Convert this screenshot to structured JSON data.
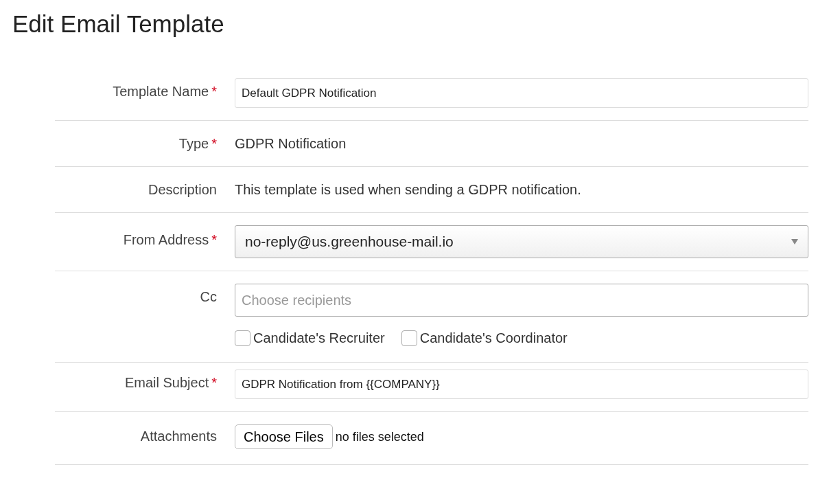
{
  "title": "Edit Email Template",
  "required_symbol": "*",
  "fields": [
    {
      "kind": "input",
      "label": "Template Name",
      "required": true,
      "value": "Default GDPR Notification"
    },
    {
      "kind": "static",
      "label": "Type",
      "required": true,
      "value": "GDPR Notification"
    },
    {
      "kind": "static",
      "label": "Description",
      "required": false,
      "value": "This template is used when sending a GDPR notification."
    },
    {
      "kind": "select",
      "label": "From Address",
      "required": true,
      "value": "no-reply@us.greenhouse-mail.io"
    },
    {
      "kind": "recipients",
      "label": "Cc",
      "required": false,
      "placeholder": "Choose recipients",
      "options": [
        {
          "label": "Candidate's Recruiter",
          "checked": false
        },
        {
          "label": "Candidate's Coordinator",
          "checked": false
        }
      ]
    },
    {
      "kind": "input",
      "label": "Email Subject",
      "required": true,
      "value": "GDPR Notification from {{COMPANY}}"
    },
    {
      "kind": "file",
      "label": "Attachments",
      "required": false,
      "button": "Choose Files",
      "status": "no files selected"
    }
  ]
}
